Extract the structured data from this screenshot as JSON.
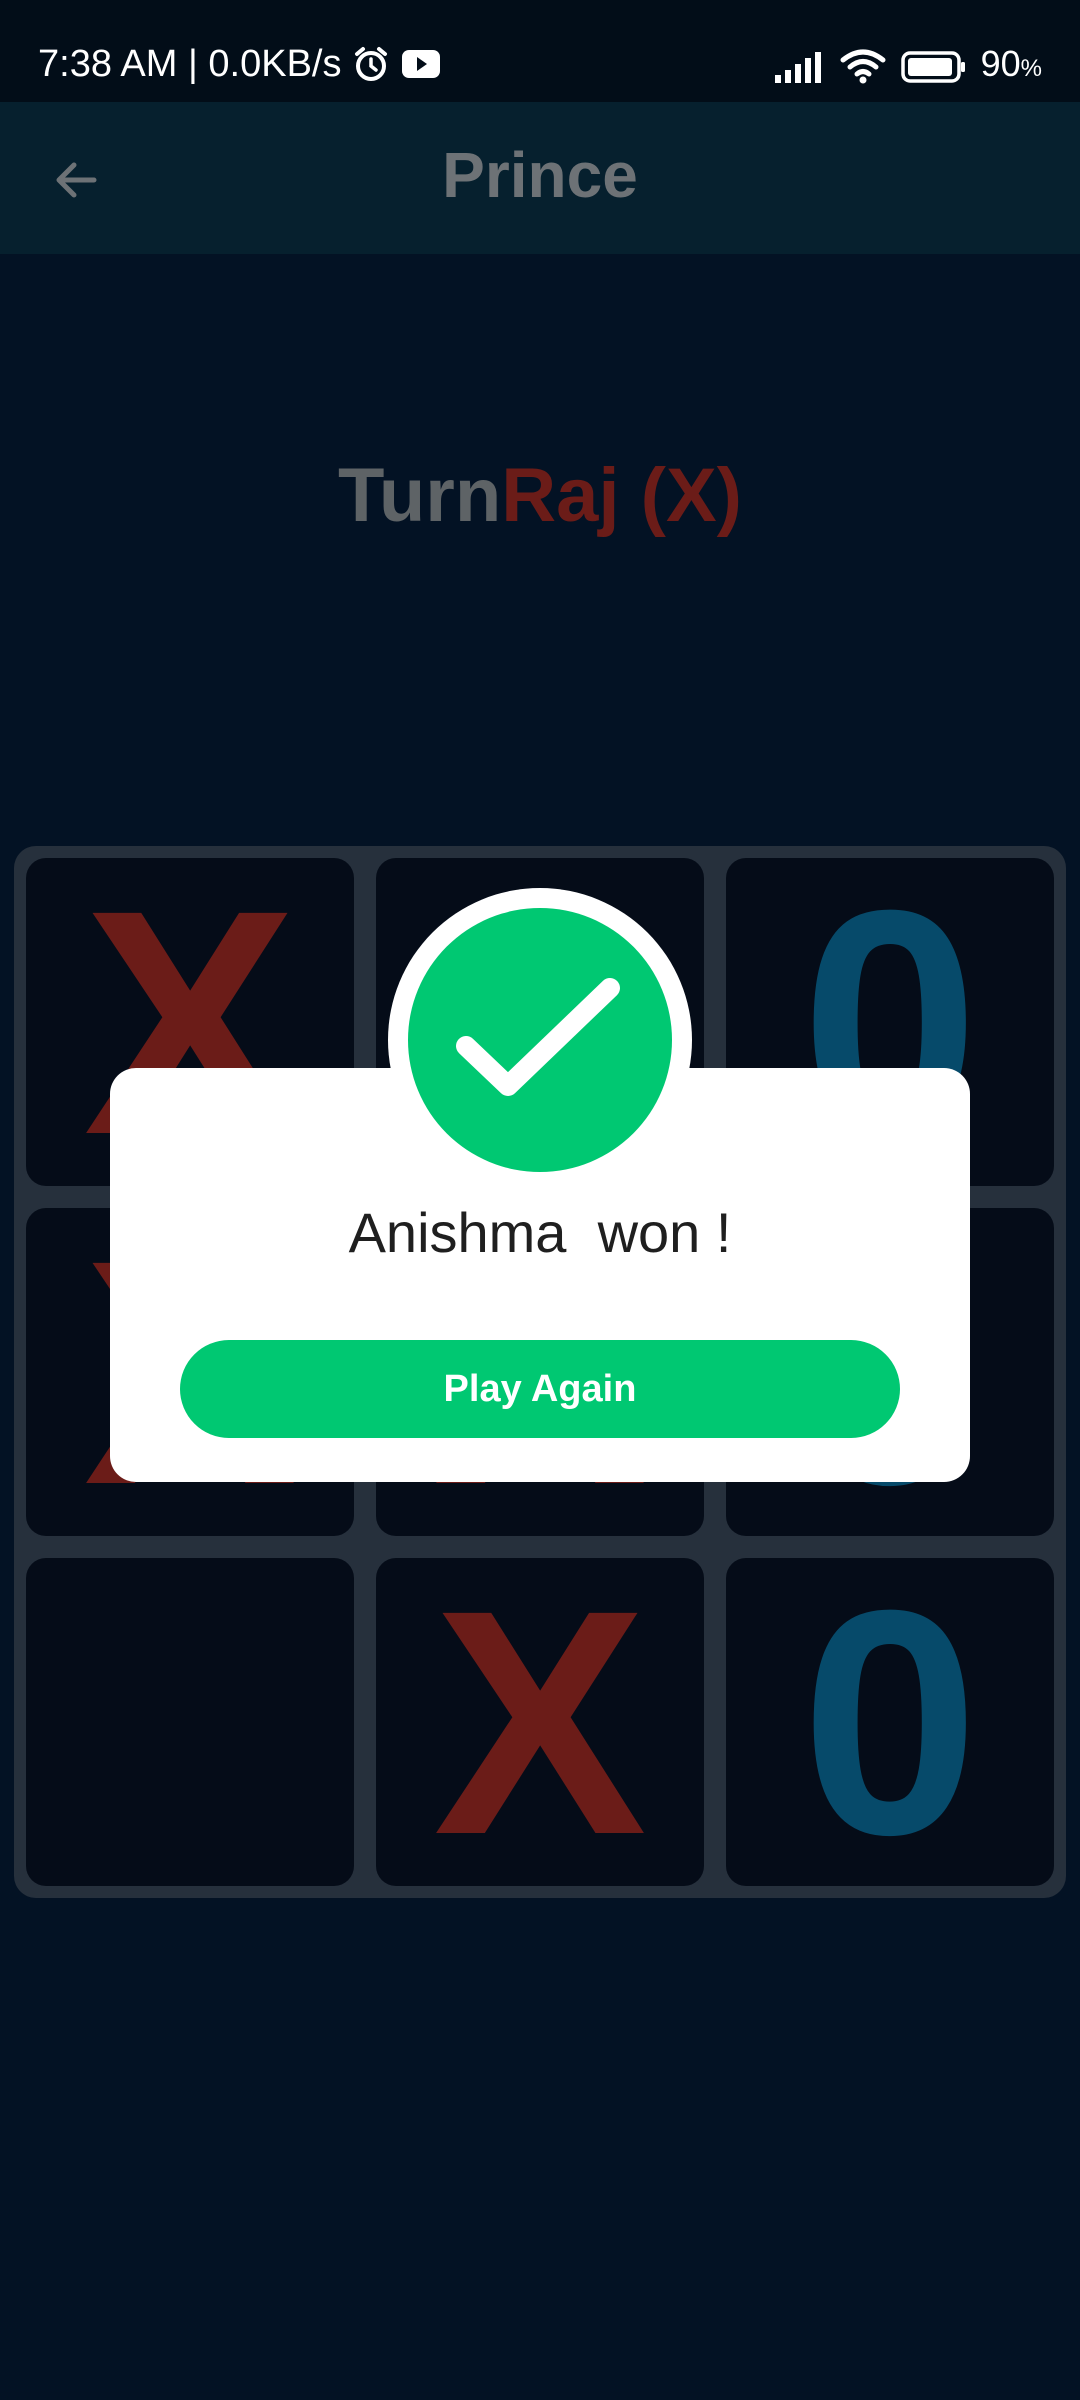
{
  "status_bar": {
    "time_speed": "7:38 AM | 0.0KB/s",
    "battery": "90",
    "battery_unit": "%",
    "icons": [
      "alarm-icon",
      "youtube-icon",
      "signal-icon",
      "wifi-icon",
      "battery-icon"
    ]
  },
  "app_bar": {
    "title": "Prince",
    "back_icon": "arrow-left-icon"
  },
  "turn": {
    "label": "Turn",
    "player": "Raj (X)"
  },
  "board": {
    "cells": [
      "X",
      "",
      "0",
      "X",
      "X",
      "0",
      "",
      "X",
      "0"
    ],
    "x_color": "#6b1c18",
    "o_color": "#064a6a"
  },
  "dialog": {
    "message": "Anishma  won !",
    "button_label": "Play Again",
    "accent": "#00c872",
    "icon": "check-circle-icon"
  }
}
